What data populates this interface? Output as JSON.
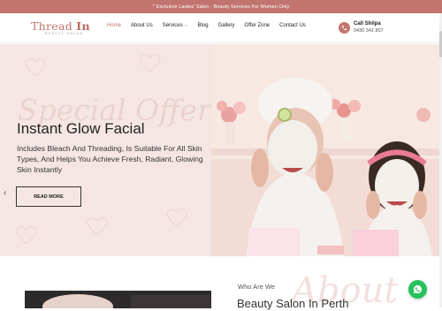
{
  "topbar": {
    "text": "* Exclusive Ladies' Salon - Beauty Services For Women Only"
  },
  "logo": {
    "name_a": "Thread ",
    "name_b": "In",
    "tagline": "BEAUTY SALON"
  },
  "nav": [
    {
      "label": "Home",
      "active": true
    },
    {
      "label": "About Us"
    },
    {
      "label": "Services",
      "has_dropdown": true
    },
    {
      "label": "Blog"
    },
    {
      "label": "Gallery"
    },
    {
      "label": "Offer Zone"
    },
    {
      "label": "Contact Us"
    }
  ],
  "call": {
    "label": "Call Shilpa",
    "number": "0430 341 807"
  },
  "hero": {
    "watermark": "Special Offer",
    "title": "Instant Glow Facial",
    "description": "Includes Bleach And Threading, Is Suitable For All Skin Types, And Helps You Achieve Fresh, Radiant, Glowing Skin Instantly",
    "button": "READ MORE"
  },
  "about": {
    "eyebrow": "Who Are We",
    "watermark": "About",
    "title": "Beauty Salon In Perth"
  },
  "colors": {
    "accent": "#c1756e",
    "whatsapp": "#25c15c"
  },
  "icons": {
    "call": "phone-icon",
    "whatsapp": "whatsapp-icon",
    "prev": "chevron-left-icon"
  }
}
